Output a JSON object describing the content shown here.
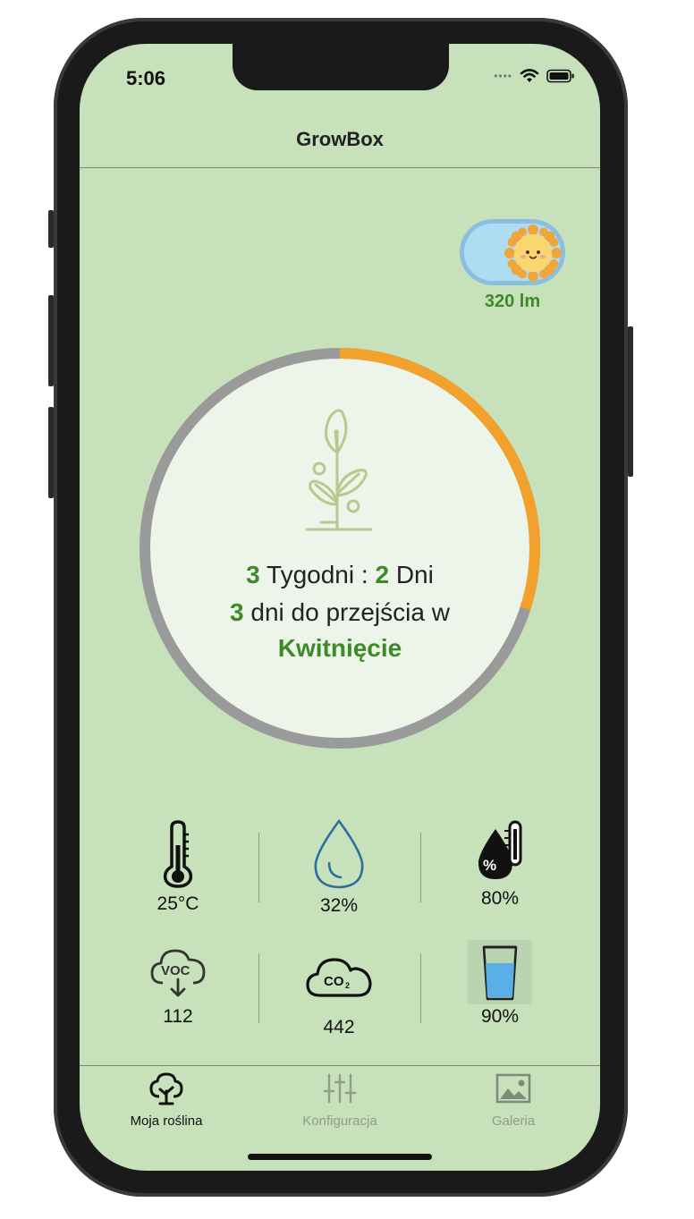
{
  "status_bar": {
    "time": "5:06"
  },
  "nav": {
    "title": "GrowBox"
  },
  "light": {
    "lumen_label": "320 lm",
    "on": true
  },
  "growth": {
    "weeks": "3",
    "weeks_label": "Tygodni :",
    "days": "2",
    "days_label": "Dni",
    "days_to_next": "3",
    "transition_text": "dni do przejścia w",
    "next_stage": "Kwitnięcie",
    "progress_fraction": 0.3,
    "progress_color": "#f2a22c",
    "track_color": "#9a9a9a"
  },
  "sensors": [
    {
      "icon": "thermometer-icon",
      "value": "25°C"
    },
    {
      "icon": "water-drop-icon",
      "value": "32%"
    },
    {
      "icon": "humidity-icon",
      "value": "80%"
    },
    {
      "icon": "voc-cloud-icon",
      "value": "112"
    },
    {
      "icon": "co2-cloud-icon",
      "value": "442"
    },
    {
      "icon": "water-glass-icon",
      "value": "90%"
    }
  ],
  "tabs": [
    {
      "label": "Moja roślina",
      "icon": "tree-icon",
      "active": true
    },
    {
      "label": "Konfiguracja",
      "icon": "sliders-icon",
      "active": false
    },
    {
      "label": "Galeria",
      "icon": "gallery-icon",
      "active": false
    }
  ],
  "colors": {
    "background": "#c7e1bb",
    "accent": "#3c8a28",
    "inactive": "#8f9c8a"
  }
}
